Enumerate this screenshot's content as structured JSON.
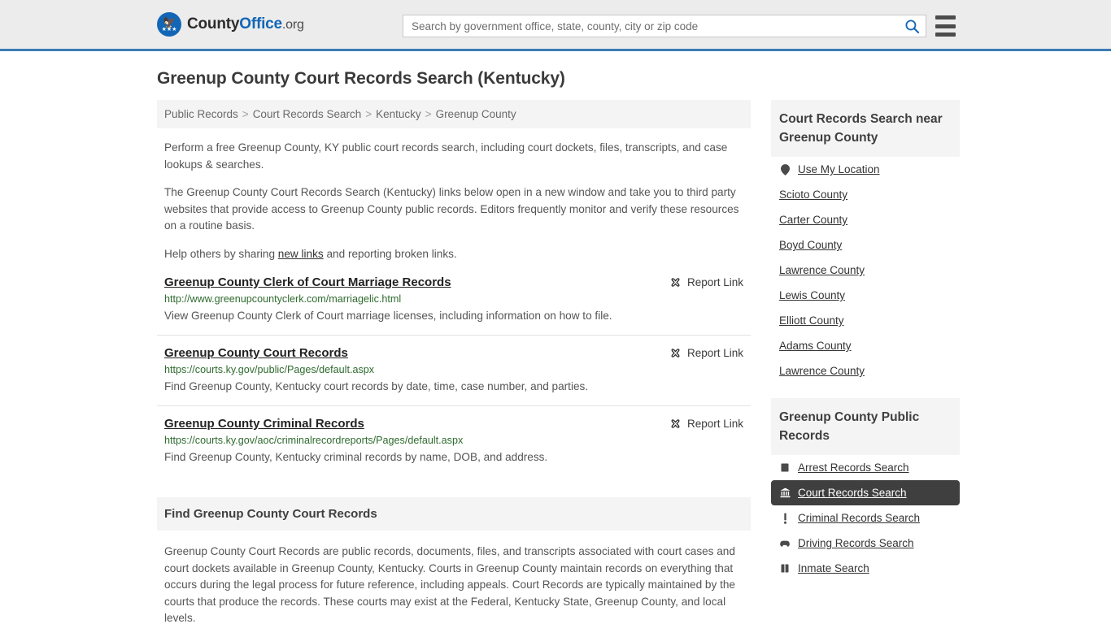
{
  "header": {
    "logo": {
      "name_part1": "County",
      "name_part2": "Office",
      "name_part3": ".org",
      "eagle_icon": "eagle-icon",
      "stars": "★★★"
    },
    "search": {
      "placeholder": "Search by government office, state, county, city or zip code",
      "value": "",
      "search_icon": "search-icon"
    },
    "menu_icon": "hamburger-menu-icon"
  },
  "page": {
    "title": "Greenup County Court Records Search (Kentucky)"
  },
  "breadcrumb": {
    "separator": ">",
    "items": [
      {
        "label": "Public Records"
      },
      {
        "label": "Court Records Search"
      },
      {
        "label": "Kentucky"
      },
      {
        "label": "Greenup County"
      }
    ]
  },
  "intro": {
    "paragraph1": "Perform a free Greenup County, KY public court records search, including court dockets, files, transcripts, and case lookups & searches.",
    "paragraph2": "The Greenup County Court Records Search (Kentucky) links below open in a new window and take you to third party websites that provide access to Greenup County public records. Editors frequently monitor and verify these resources on a routine basis.",
    "paragraph3_before": "Help others by sharing ",
    "paragraph3_link": "new links",
    "paragraph3_after": " and reporting broken links."
  },
  "report_link_label": "Report Link",
  "report_link_icon": "broken-link-icon",
  "links": [
    {
      "title": "Greenup County Clerk of Court Marriage Records",
      "url": "http://www.greenupcountyclerk.com/marriagelic.html",
      "description": "View Greenup County Clerk of Court marriage licenses, including information on how to file."
    },
    {
      "title": "Greenup County Court Records",
      "url": "https://courts.ky.gov/public/Pages/default.aspx",
      "description": "Find Greenup County, Kentucky court records by date, time, case number, and parties."
    },
    {
      "title": "Greenup County Criminal Records",
      "url": "https://courts.ky.gov/aoc/criminalrecordreports/Pages/default.aspx",
      "description": "Find Greenup County, Kentucky criminal records by name, DOB, and address."
    }
  ],
  "find_section": {
    "heading": "Find Greenup County Court Records",
    "body": "Greenup County Court Records are public records, documents, files, and transcripts associated with court cases and court dockets available in Greenup County, Kentucky. Courts in Greenup County maintain records on everything that occurs during the legal process for future reference, including appeals. Court Records are typically maintained by the courts that produce the records. These courts may exist at the Federal, Kentucky State, Greenup County, and local levels."
  },
  "sidebar": {
    "nearby": {
      "heading": "Court Records Search near Greenup County",
      "items": [
        {
          "label": "Use My Location",
          "icon": "location-pin-icon"
        },
        {
          "label": "Scioto County",
          "icon": ""
        },
        {
          "label": "Carter County",
          "icon": ""
        },
        {
          "label": "Boyd County",
          "icon": ""
        },
        {
          "label": "Lawrence County",
          "icon": ""
        },
        {
          "label": "Lewis County",
          "icon": ""
        },
        {
          "label": "Elliott County",
          "icon": ""
        },
        {
          "label": "Adams County",
          "icon": ""
        },
        {
          "label": "Lawrence County",
          "icon": ""
        }
      ]
    },
    "public_records": {
      "heading": "Greenup County Public Records",
      "items": [
        {
          "label": "Arrest Records Search",
          "icon": "book-icon",
          "active": false
        },
        {
          "label": "Court Records Search",
          "icon": "courthouse-icon",
          "active": true
        },
        {
          "label": "Criminal Records Search",
          "icon": "exclamation-icon",
          "active": false
        },
        {
          "label": "Driving Records Search",
          "icon": "car-icon",
          "active": false
        },
        {
          "label": "Inmate Search",
          "icon": "jail-icon",
          "active": false
        }
      ]
    }
  },
  "colors": {
    "brand_blue": "#1266b5",
    "header_border": "#3b7cb5",
    "header_bg": "#ececec",
    "url_green": "#2e6b2e",
    "panel_gray": "#f4f4f4",
    "active_dark": "#3f3f3f"
  }
}
